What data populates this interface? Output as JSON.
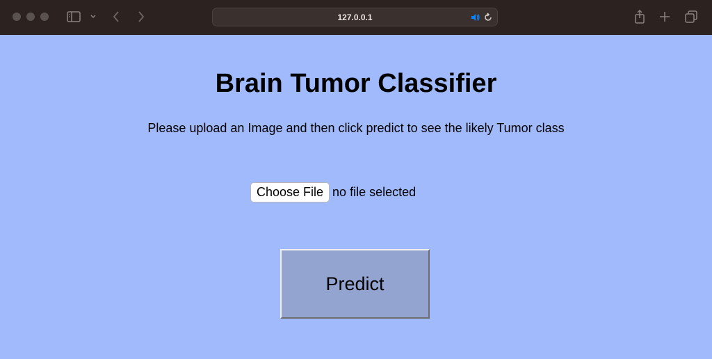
{
  "browser": {
    "url": "127.0.0.1",
    "icons": {
      "sidebar": "sidebar-icon",
      "chevron": "chevron-down-icon",
      "back": "back-arrow-icon",
      "forward": "forward-arrow-icon",
      "speaker": "speaker-icon",
      "reload": "reload-icon",
      "share": "share-icon",
      "new_tab": "plus-icon",
      "tabs": "tab-overview-icon"
    },
    "accent_color": "#0a84ff"
  },
  "page": {
    "background": "#a1bafc",
    "title": "Brain Tumor Classifier",
    "subtitle": "Please upload an Image and then click predict to see the likely Tumor class",
    "file_input": {
      "button_label": "Choose File",
      "status": "no file selected"
    },
    "predict_label": "Predict"
  }
}
